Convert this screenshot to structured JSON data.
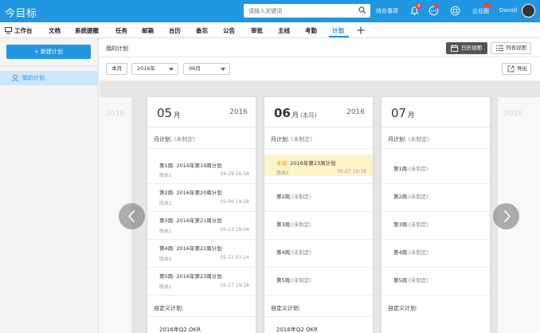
{
  "app": {
    "title": "今目标"
  },
  "top": {
    "search_placeholder": "请输入关键词",
    "todo_label": "待办事项",
    "notifications_count": "6",
    "enterprise_label": "企业圈",
    "user_name": "David("
  },
  "nav": {
    "items": [
      "工作台",
      "文档",
      "系统提醒",
      "任务",
      "邮箱",
      "台历",
      "备忘",
      "公告",
      "审批",
      "主线",
      "考勤",
      "计划"
    ],
    "active": "计划",
    "add_icon": "plus-icon"
  },
  "sidebar": {
    "new_button": "+ 新建计划",
    "my_plan": "我的计划"
  },
  "content": {
    "title": "我的计划",
    "view_calendar": "日历视图",
    "view_list": "列表视图",
    "filter_month": "本月",
    "filter_year": "2016年",
    "filter_mon": "06月",
    "export": "导出"
  },
  "columns": {
    "may": {
      "month": "05",
      "unit": "月",
      "year": "2016",
      "plan_label": "月计划:",
      "plan_status": "(未制定)",
      "weeks": [
        {
          "name": "第1周:",
          "plan": "2016年第19周计划",
          "version": "版本1",
          "date": "04-29 16:58"
        },
        {
          "name": "第2周:",
          "plan": "2016年第20周计划",
          "version": "版本1",
          "date": "05-06 19:58"
        },
        {
          "name": "第3周:",
          "plan": "2016年第21周计划",
          "version": "版本1",
          "date": "05-13 18:04"
        },
        {
          "name": "第4周:",
          "plan": "2016年第22周计划",
          "version": "版本2",
          "date": "05-21 07:14"
        },
        {
          "name": "第5周:",
          "plan": "2016年第23周计划",
          "version": "版本1",
          "date": "05-27 19:18"
        }
      ],
      "custom_label": "自定义计划:",
      "okr": "2016年Q2 OKR"
    },
    "jun": {
      "month": "06",
      "unit": "月",
      "current": "(本月)",
      "year": "2016",
      "plan_label": "月计划:",
      "plan_status": "(未制定)",
      "current_week_tag": "本周:",
      "current_week_plan": "2016年第23周计划",
      "current_week_version": "版本1",
      "current_week_date": "05-27 19:18",
      "weeks": [
        {
          "name": "第2周:",
          "status": "(未制定)"
        },
        {
          "name": "第3周:",
          "status": "(未制定)"
        },
        {
          "name": "第4周:",
          "status": "(未制定)"
        },
        {
          "name": "第5周:",
          "status": "(未制定)"
        }
      ],
      "custom_label": "自定义计划:",
      "okr": "2016年Q2 OKR"
    },
    "jul": {
      "month": "07",
      "unit": "月",
      "plan_label": "月计划:",
      "plan_status": "(未制定)",
      "weeks": [
        {
          "name": "第1周:",
          "status": "(未制定)"
        },
        {
          "name": "第2周:",
          "status": "(未制定)"
        },
        {
          "name": "第3周:",
          "status": "(未制定)"
        },
        {
          "name": "第4周:",
          "status": "(未制定)"
        },
        {
          "name": "第5周:",
          "status": "(未制定)"
        }
      ],
      "custom_label": "自定义计划:"
    },
    "ghost_left_year": "2016",
    "ghost_right_year": "2016"
  },
  "colors": {
    "brand": "#2196e3",
    "highlight": "#fdf4c8",
    "current_tag": "#f39c12"
  }
}
